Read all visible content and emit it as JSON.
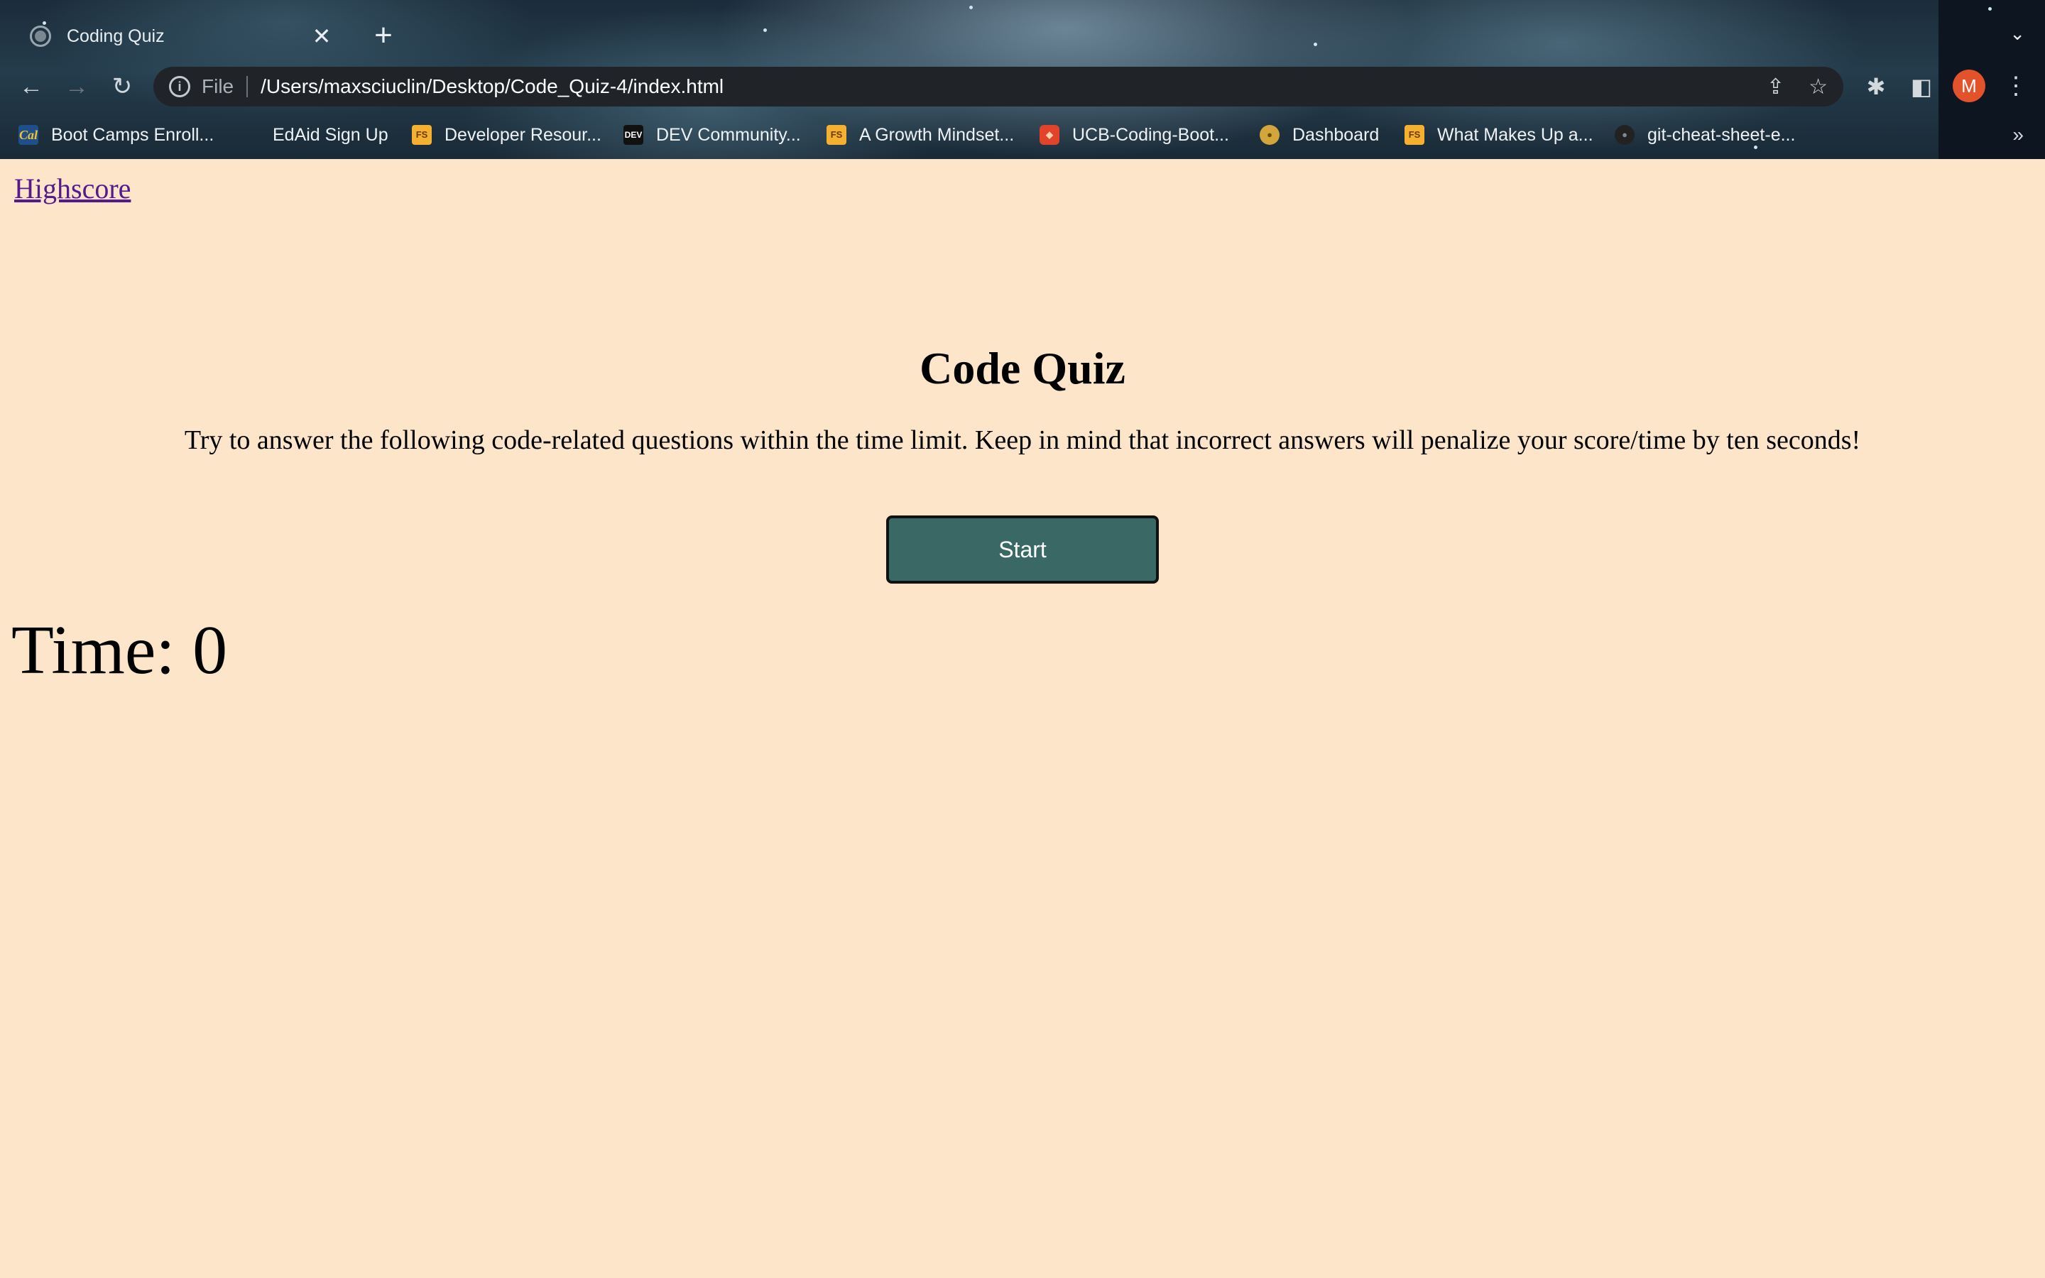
{
  "browser": {
    "tab_title": "Coding Quiz",
    "tab_close": "✕",
    "new_tab": "+",
    "url_scheme": "File",
    "url": "/Users/maxsciuclin/Desktop/Code_Quiz-4/index.html",
    "profile_initial": "M",
    "bookmarks": [
      {
        "label": "Boot Camps Enroll...",
        "icon": "cal-icon"
      },
      {
        "label": "EdAid Sign Up",
        "icon": "none"
      },
      {
        "label": "Developer Resour...",
        "icon": "fs-icon"
      },
      {
        "label": "DEV Community...",
        "icon": "dev-icon"
      },
      {
        "label": "A Growth Mindset...",
        "icon": "fs-icon"
      },
      {
        "label": "UCB-Coding-Boot...",
        "icon": "gitlab-icon"
      },
      {
        "label": "Dashboard",
        "icon": "dashboard-icon"
      },
      {
        "label": "What Makes Up a...",
        "icon": "fs-icon"
      },
      {
        "label": "git-cheat-sheet-e...",
        "icon": "github-icon"
      }
    ],
    "bookmarks_more": "»"
  },
  "page": {
    "highscore_link": "Highscore",
    "title": "Code Quiz",
    "intro": "Try to answer the following code-related questions within the time limit. Keep in mind that incorrect answers will penalize your score/time by ten seconds!",
    "start_button": "Start",
    "timer": "Time: 0"
  },
  "colors": {
    "page_background": "#fce5c9",
    "start_button": "#3a6965",
    "link": "#551a8b",
    "avatar": "#e2532b"
  }
}
